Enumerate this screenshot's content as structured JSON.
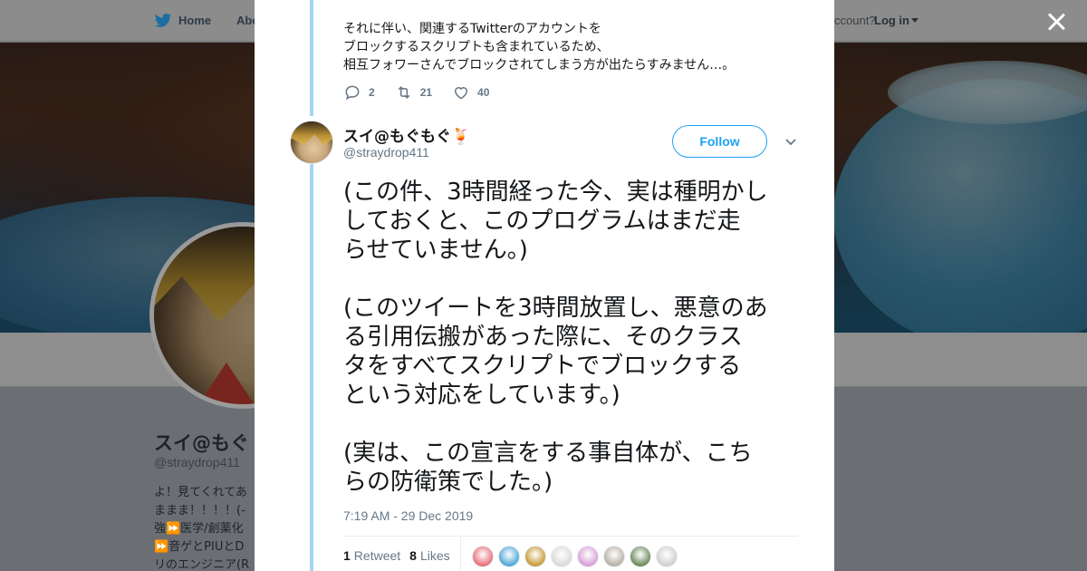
{
  "nav": {
    "home_label": "Home",
    "about_label": "Abo",
    "account_prompt": "ccount?",
    "login_label": "Log in"
  },
  "profile": {
    "name": "スイ@もぐ",
    "handle": "@straydrop411",
    "bio_lines": [
      "よ！見てくれてあ",
      "ままま！！！！(-",
      "強⏩医学/創薬化",
      "⏩音ゲとPIUとD",
      "リのエンジニア(R"
    ]
  },
  "prev_tweet": {
    "lines": [
      "それに伴い、関連するTwitterのアカウントを",
      "ブロックするスクリプトも含まれているため、",
      "相互フォワーさんでブロックされてしまう方が出たらすみません…。"
    ],
    "reply_count": "2",
    "retweet_count": "21",
    "like_count": "40"
  },
  "tweet": {
    "author_name": "スイ@もぐもぐ🍹",
    "author_handle": "@straydrop411",
    "follow_label": "Follow",
    "text_lines": [
      "(この件、3時間経った今、実は種明かし",
      "しておくと、このプログラムはまだ走",
      "らせていません。)",
      "",
      "(このツイートを3時間放置し、悪意のあ",
      "る引用伝搬があった際に、そのクラス",
      "タをすべてスクリプトでブロックする",
      "という対応をしています。)",
      "",
      "(実は、この宣言をする事自体が、こち",
      "らの防衛策でした。)"
    ],
    "timestamp": "7:19 AM - 29 Dec 2019",
    "retweets_count": "1",
    "retweets_label": "Retweet",
    "likes_count": "8",
    "likes_label": "Likes"
  },
  "colors": {
    "twitter_blue": "#1da1f2",
    "thread_line": "#a6d6f4",
    "muted_text": "#657786",
    "text": "#14171a"
  },
  "likers": [
    {
      "name": "liker-1",
      "color": "#e8707a"
    },
    {
      "name": "liker-2",
      "color": "#4fa9d8"
    },
    {
      "name": "liker-3",
      "color": "#c99b3a"
    },
    {
      "name": "liker-4",
      "color": "#d9d9d9"
    },
    {
      "name": "liker-5",
      "color": "#d8a0d6"
    },
    {
      "name": "liker-6",
      "color": "#b8b0a6"
    },
    {
      "name": "liker-7",
      "color": "#6d8b5a"
    },
    {
      "name": "liker-8",
      "color": "#cfcfcf"
    }
  ]
}
